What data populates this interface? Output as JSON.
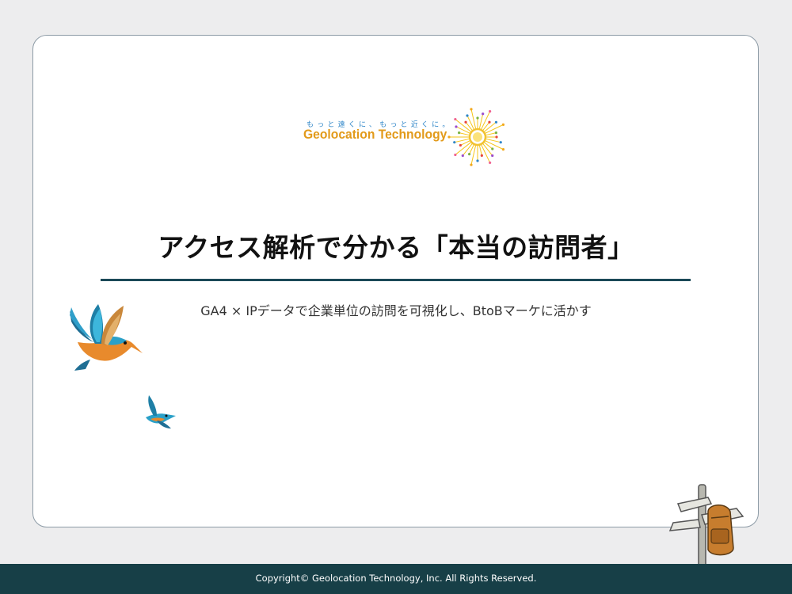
{
  "logo": {
    "tagline": "もっと遠くに、もっと近くに。",
    "name": "Geolocation Technology"
  },
  "slide": {
    "title": "アクセス解析で分かる「本当の訪問者」",
    "subtitle": "GA4 × IPデータで企業単位の訪問を可視化し、BtoBマーケに活かす"
  },
  "footer": {
    "copyright": "Copyright© Geolocation Technology, Inc. All Rights Reserved."
  },
  "colors": {
    "background": "#ededee",
    "card_border": "#8d9ba6",
    "rule": "#1b4957",
    "footer_bg": "#173f47",
    "logo_orange": "#e29a1a",
    "logo_blue": "#2f86c8"
  },
  "icons": [
    "kingfisher-large-icon",
    "kingfisher-small-icon",
    "signpost-backpack-icon",
    "sunburst-logo-icon"
  ]
}
